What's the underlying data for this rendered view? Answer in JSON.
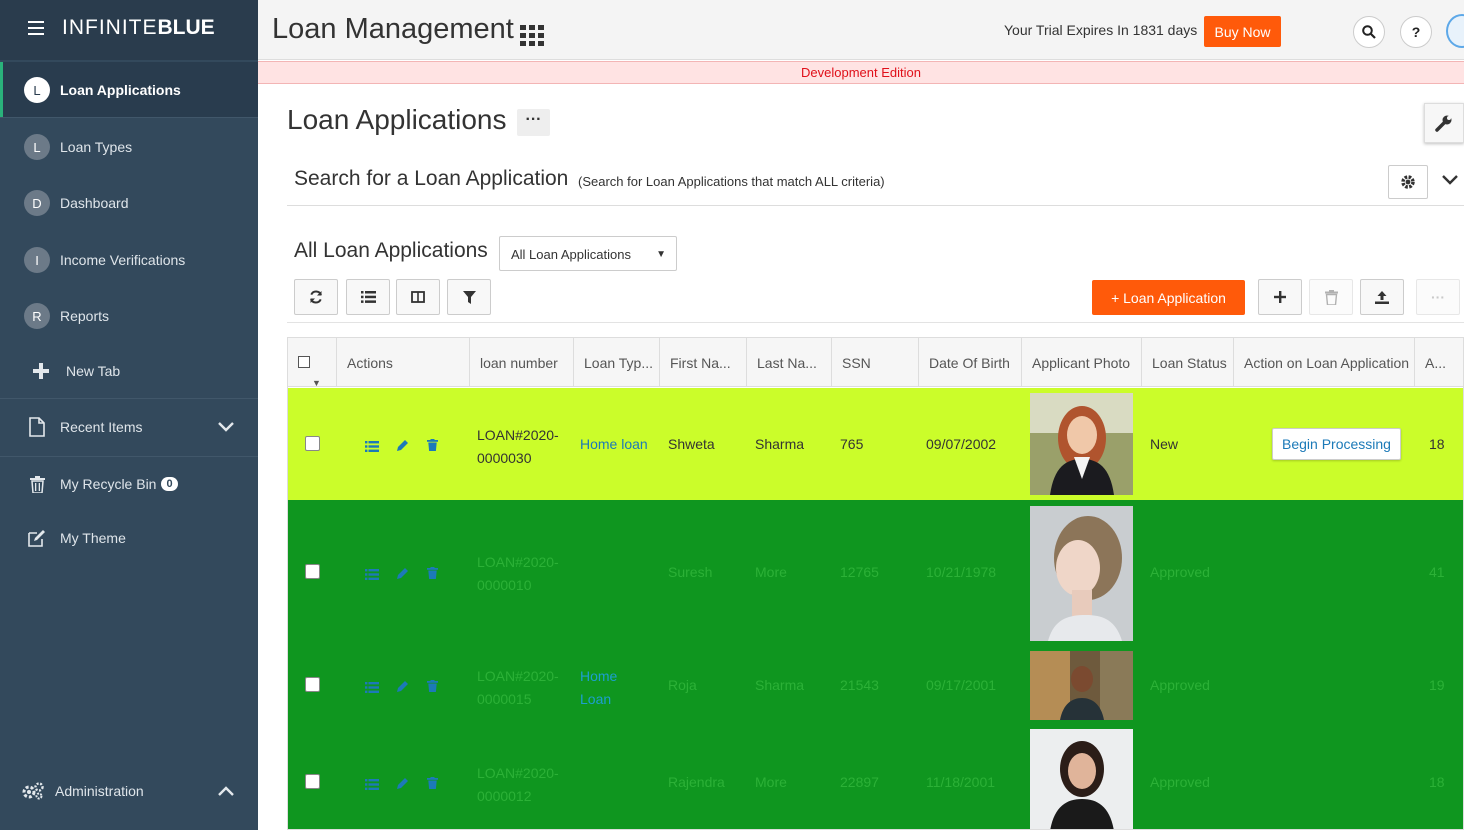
{
  "brand": {
    "thin": "INFINITE",
    "bold": "BLUE"
  },
  "sidebar": {
    "items": [
      {
        "initial": "L",
        "label": "Loan Applications"
      },
      {
        "initial": "L",
        "label": "Loan Types"
      },
      {
        "initial": "D",
        "label": "Dashboard"
      },
      {
        "initial": "I",
        "label": "Income Verifications"
      },
      {
        "initial": "R",
        "label": "Reports"
      }
    ],
    "new_tab": "New Tab",
    "recent_items": "Recent Items",
    "recycle_bin": "My Recycle Bin",
    "recycle_count": "0",
    "my_theme": "My Theme",
    "administration": "Administration"
  },
  "header": {
    "app_title": "Loan Management",
    "trial_text": "Your Trial Expires In 1831 days",
    "buy_label": "Buy Now",
    "search_icon": "search-icon",
    "help_label": "?"
  },
  "dev_banner": "Development Edition",
  "page": {
    "title": "Loan Applications",
    "more": "···",
    "search_title": "Search for a Loan Application",
    "search_subtitle": "(Search for Loan Applications that match ALL criteria)",
    "list_title": "All Loan Applications",
    "view_selected": "All Loan Applications",
    "new_button": "+ Loan Application"
  },
  "colors": {
    "accent": "#ff5a0a",
    "sidebar": "#33495c",
    "row_new": "#cbfd2a",
    "row_approved": "#0f961f",
    "link": "#1c7ab8"
  },
  "table": {
    "columns": [
      "Actions",
      "loan number",
      "Loan Typ...",
      "First Na...",
      "Last Na...",
      "SSN",
      "Date Of Birth",
      "Applicant Photo",
      "Loan Status",
      "Action on Loan Application",
      "A..."
    ],
    "rows": [
      {
        "loan1": "LOAN#2020-",
        "loan2": "0000030",
        "type1": "Home loan",
        "type2": "",
        "first": "Shweta",
        "last": "Sharma",
        "ssn": "765",
        "dob": "09/07/2002",
        "status": "New",
        "action": "Begin Processing",
        "age": "18"
      },
      {
        "loan1": "LOAN#2020-",
        "loan2": "0000010",
        "type1": "",
        "type2": "",
        "first": "Suresh",
        "last": "More",
        "ssn": "12765",
        "dob": "10/21/1978",
        "status": "Approved",
        "action": "",
        "age": "41"
      },
      {
        "loan1": "LOAN#2020-",
        "loan2": "0000015",
        "type1": "Home",
        "type2": "Loan",
        "first": "Roja",
        "last": "Sharma",
        "ssn": "21543",
        "dob": "09/17/2001",
        "status": "Approved",
        "action": "",
        "age": "19"
      },
      {
        "loan1": "LOAN#2020-",
        "loan2": "0000012",
        "type1": "",
        "type2": "",
        "first": "Rajendra",
        "last": "More",
        "ssn": "22897",
        "dob": "11/18/2001",
        "status": "Approved",
        "action": "",
        "age": "18"
      }
    ]
  }
}
